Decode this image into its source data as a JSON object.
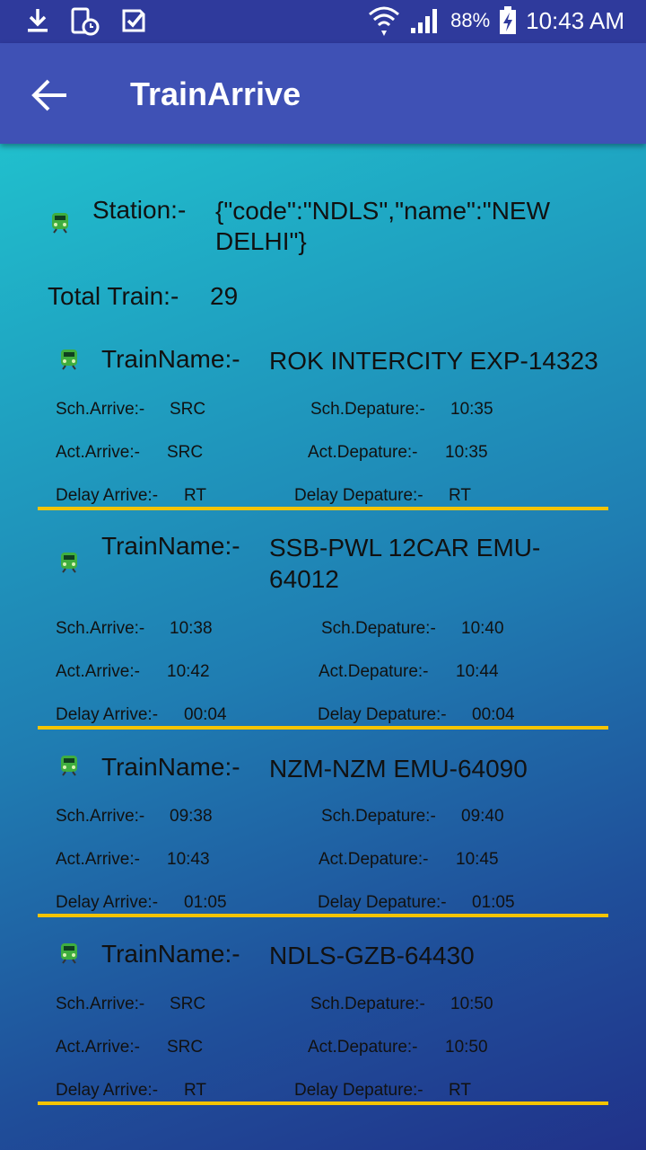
{
  "status_bar": {
    "time": "10:43 AM",
    "battery": "88%",
    "left_icons": [
      "download-icon",
      "phone-clock-icon",
      "checklist-icon"
    ],
    "right_icons": [
      "wifi-icon",
      "signal-icon",
      "battery-charging-icon"
    ]
  },
  "app_bar": {
    "title": "TrainArrive",
    "back_icon": "back-arrow-icon"
  },
  "station": {
    "label": "Station:-",
    "value": "{\"code\":\"NDLS\",\"name\":\"NEW DELHI\"}"
  },
  "total": {
    "label": "Total Train:-",
    "value": "29"
  },
  "labels": {
    "train_name": "TrainName:-",
    "sch_arrive": "Sch.Arrive:-",
    "sch_depature": "Sch.Depature:-",
    "act_arrive": "Act.Arrive:-",
    "act_depature": "Act.Depature:-",
    "delay_arrive": "Delay Arrive:-",
    "delay_depature": "Delay Depature:-"
  },
  "trains": [
    {
      "name": "ROK INTERCITY EXP-14323",
      "sch_arrive": "SRC",
      "sch_depature": "10:35",
      "act_arrive": "SRC",
      "act_depature": "10:35",
      "delay_arrive": "RT",
      "delay_depature": "RT"
    },
    {
      "name": "SSB-PWL 12CAR EMU-64012",
      "sch_arrive": "10:38",
      "sch_depature": "10:40",
      "act_arrive": "10:42",
      "act_depature": "10:44",
      "delay_arrive": "00:04",
      "delay_depature": "00:04"
    },
    {
      "name": "NZM-NZM EMU-64090",
      "sch_arrive": "09:38",
      "sch_depature": "09:40",
      "act_arrive": "10:43",
      "act_depature": "10:45",
      "delay_arrive": "01:05",
      "delay_depature": "01:05"
    },
    {
      "name": "NDLS-GZB-64430",
      "sch_arrive": "SRC",
      "sch_depature": "10:50",
      "act_arrive": "SRC",
      "act_depature": "10:50",
      "delay_arrive": "RT",
      "delay_depature": "RT"
    }
  ],
  "colors": {
    "status_bar": "#2f3a9c",
    "app_bar": "#3f51b5",
    "divider": "#f5c400",
    "train_icon": "#3fae3f"
  }
}
